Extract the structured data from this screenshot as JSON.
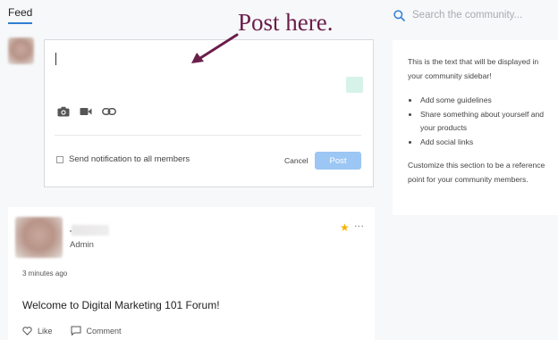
{
  "nav": {
    "feed_tab": "Feed"
  },
  "search": {
    "placeholder": "Search the community...",
    "icon": "search-icon"
  },
  "composer": {
    "tools": [
      "camera-icon",
      "video-icon",
      "link-icon"
    ],
    "notify_label": "Send notification to all members",
    "cancel_label": "Cancel",
    "post_label": "Post"
  },
  "annotation": {
    "text": "Post here."
  },
  "sidebar": {
    "intro": "This is the text that will be displayed in your community sidebar!",
    "bullets": [
      "Add some guidelines",
      "Share something about yourself and your products",
      "Add social links"
    ],
    "outro": "Customize this section to be a reference point for your community members."
  },
  "post": {
    "role": "Admin",
    "time": "3 minutes ago",
    "body": "Welcome to Digital Marketing 101 Forum!",
    "like_label": "Like",
    "comment_label": "Comment"
  },
  "colors": {
    "accent": "#2f7fd3",
    "post_button": "#9cc6f3",
    "annotation": "#6a1e4a",
    "star": "#f6b400"
  }
}
